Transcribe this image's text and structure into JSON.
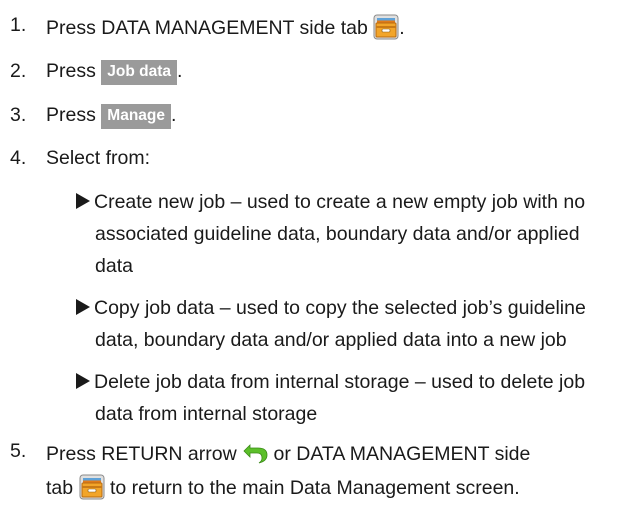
{
  "steps": [
    {
      "num": "1.",
      "pre": "Press DATA MANAGEMENT side tab",
      "post": "."
    },
    {
      "num": "2.",
      "pre": "Press",
      "button": "Job data",
      "post": "."
    },
    {
      "num": "3.",
      "pre": "Press",
      "button": "Manage",
      "post": "."
    },
    {
      "num": "4.",
      "text": "Select from:"
    },
    {
      "num": "5.",
      "line1_pre": "Press RETURN arrow",
      "line1_post": "or DATA MANAGEMENT side",
      "line2_pre": "tab",
      "line2_post": "to return to the main Data Management screen."
    }
  ],
  "bullets": [
    {
      "lines": [
        "Create new job – used to create a new empty job with no",
        "associated guideline data, boundary data and/or applied",
        "data"
      ]
    },
    {
      "lines": [
        "Copy job data – used to copy the selected job’s guideline",
        "data, boundary data and/or applied data into a new job"
      ]
    },
    {
      "lines": [
        "Delete job data from internal storage – used to delete job",
        "data from internal storage"
      ]
    }
  ],
  "icons": {
    "data_management": "file-cabinet-icon",
    "return": "return-arrow-icon"
  },
  "colors": {
    "button_bg": "#9a9a9a",
    "button_text": "#ffffff",
    "icon_drawer": "#f0a020",
    "return_arrow": "#5cbf2a"
  }
}
